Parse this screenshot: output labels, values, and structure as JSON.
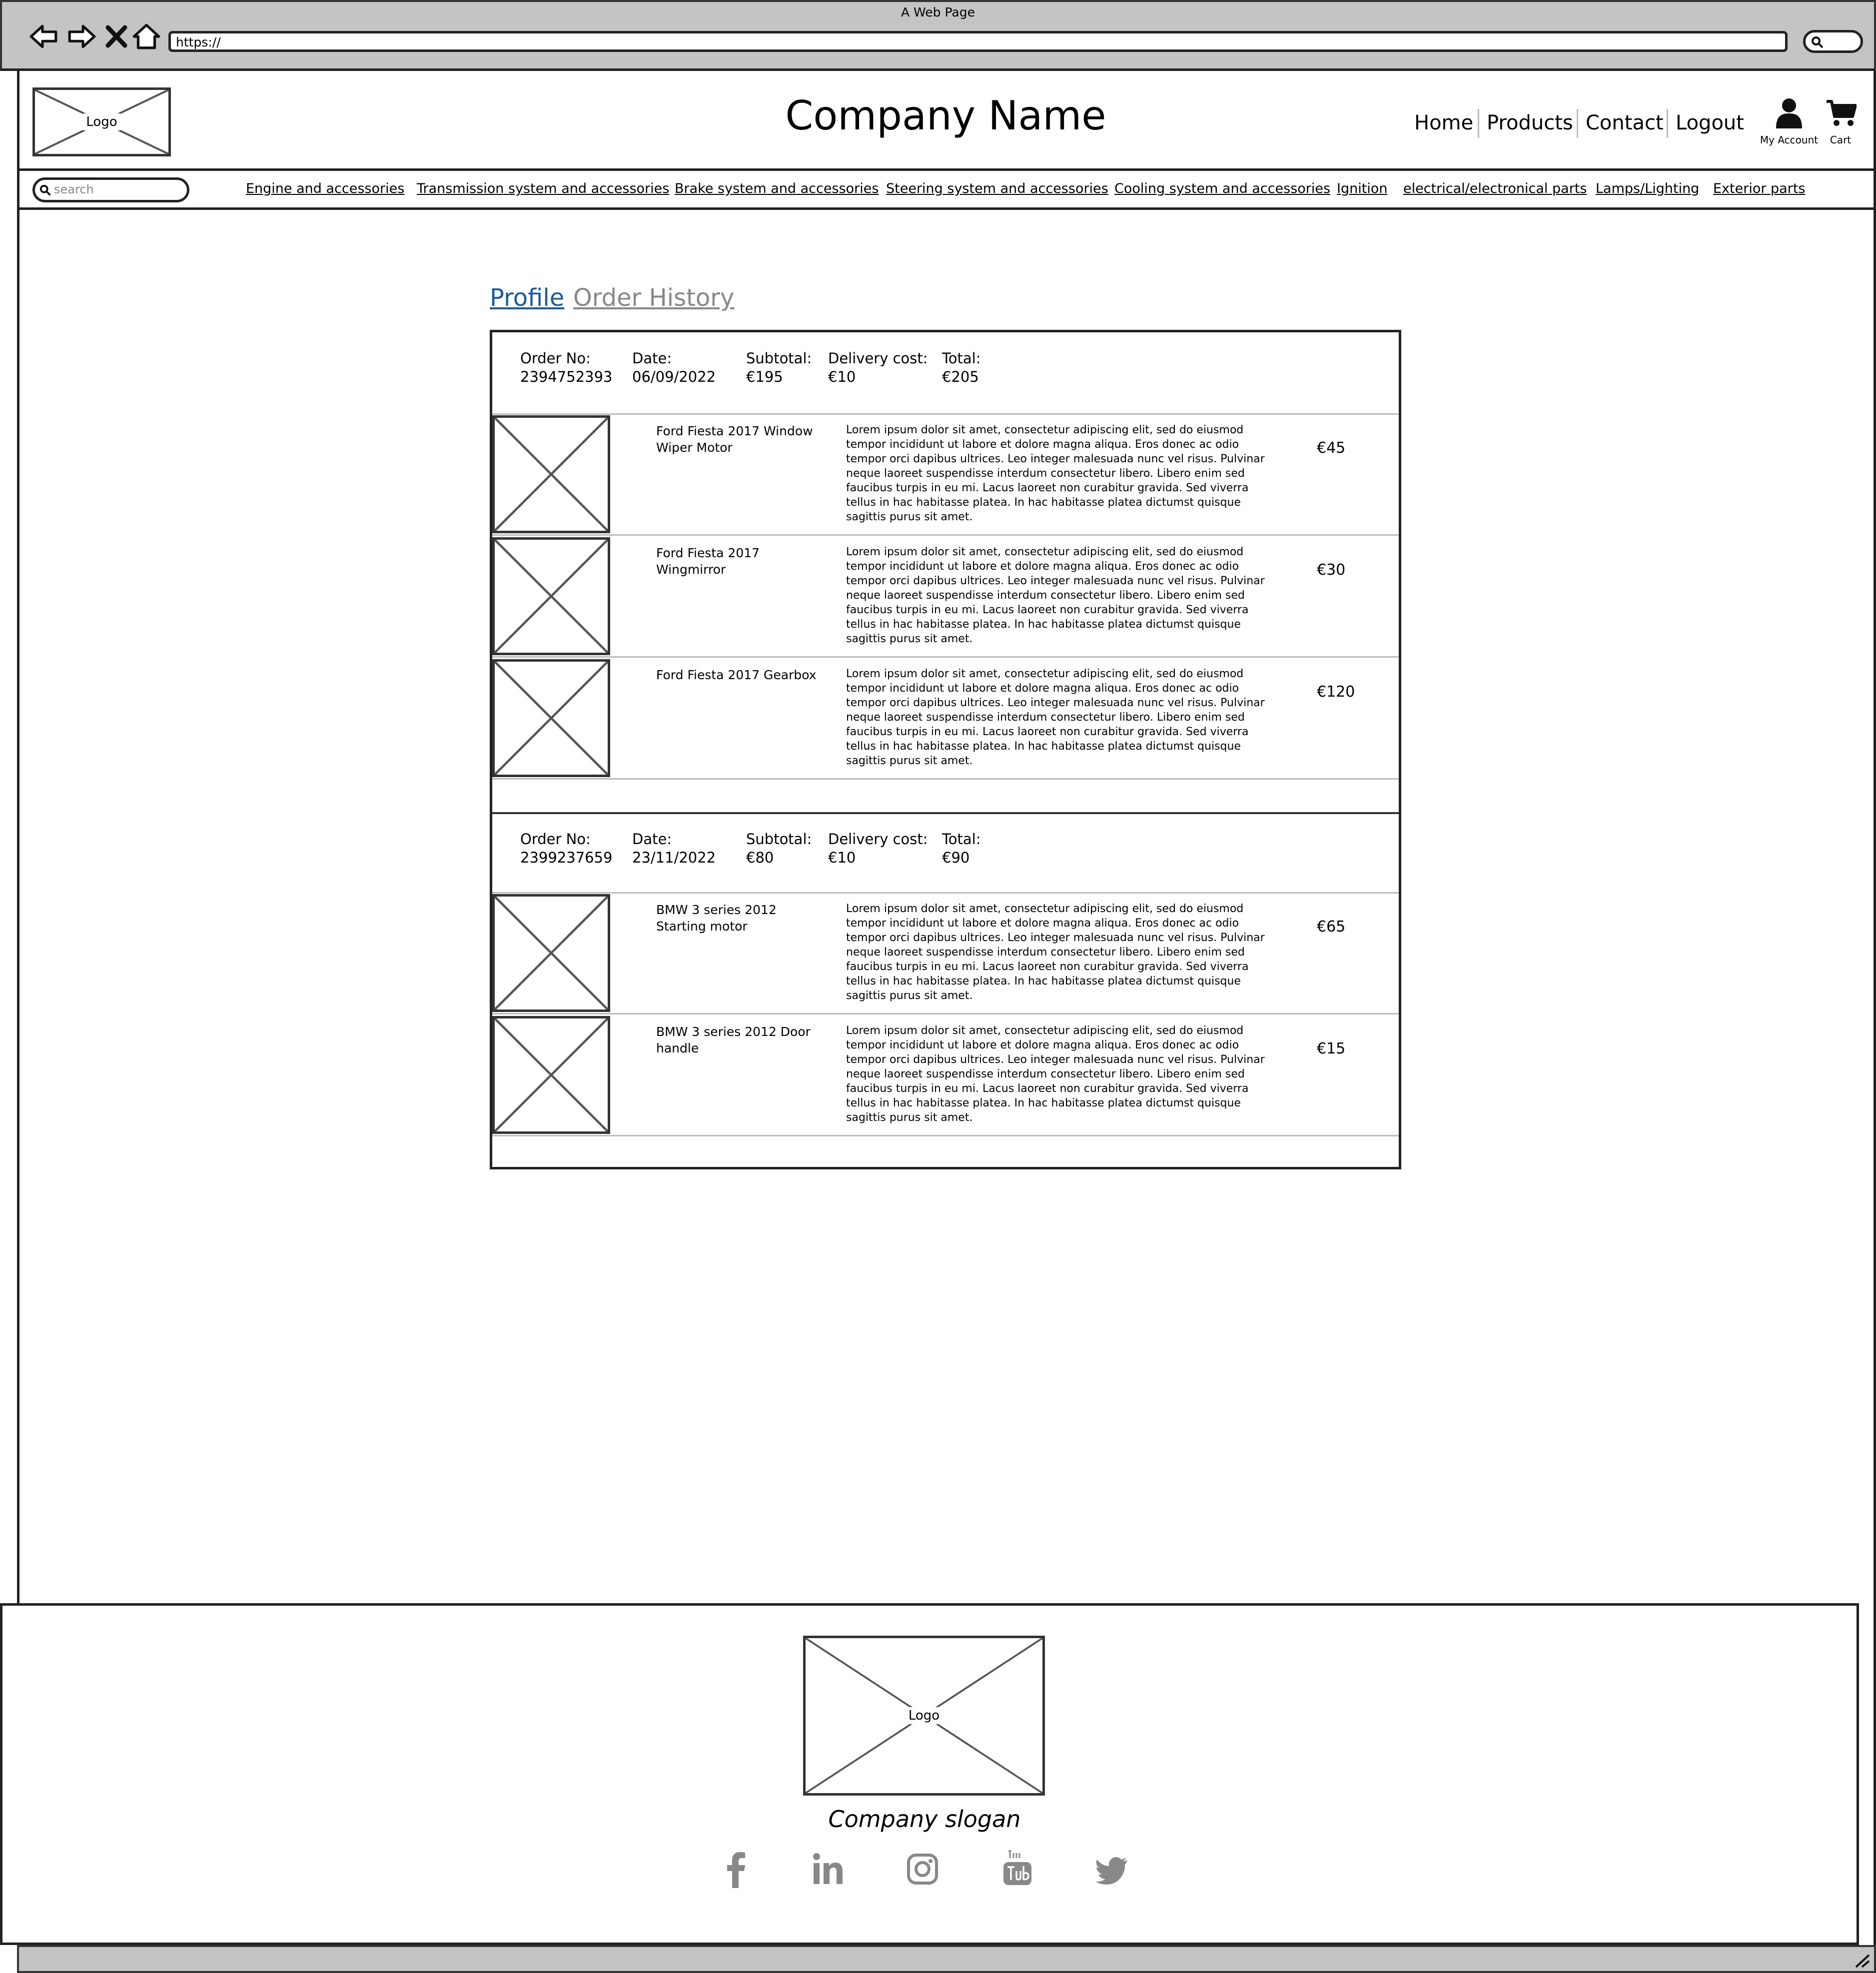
{
  "browser": {
    "title": "A Web Page",
    "url": "https://"
  },
  "header": {
    "logo": "Logo",
    "company_name": "Company Name",
    "nav": [
      "Home",
      "Products",
      "Contact",
      "Logout"
    ],
    "account_label": "My Account",
    "cart_label": "Cart"
  },
  "search": {
    "placeholder": "search"
  },
  "categories": [
    "Engine and accessories",
    "Transmission system and accessories",
    "Brake system and accessories",
    "Steering system and accessories",
    "Cooling system and accessories",
    "Ignition",
    "electrical/electronical parts",
    "Lamps/Lighting",
    "Exterior parts"
  ],
  "tabs": {
    "profile": "Profile",
    "order_history": "Order History"
  },
  "meta_labels": {
    "order_no": "Order No:",
    "date": "Date:",
    "subtotal": "Subtotal:",
    "delivery": "Delivery cost:",
    "total": "Total:"
  },
  "orders": [
    {
      "order_no": "2394752393",
      "date": "06/09/2022",
      "subtotal": "€195",
      "delivery": "€10",
      "total": "€205",
      "items": [
        {
          "name": "Ford Fiesta 2017 Window Wiper Motor",
          "price": "€45"
        },
        {
          "name": "Ford Fiesta 2017 Wingmirror",
          "price": "€30"
        },
        {
          "name": "Ford Fiesta 2017 Gearbox",
          "price": "€120"
        }
      ]
    },
    {
      "order_no": "2399237659",
      "date": "23/11/2022",
      "subtotal": "€80",
      "delivery": "€10",
      "total": "€90",
      "items": [
        {
          "name": "BMW 3 series 2012 Starting motor",
          "price": "€65"
        },
        {
          "name": "BMW 3 series 2012 Door handle",
          "price": "€15"
        }
      ]
    }
  ],
  "item_description": "Lorem ipsum dolor sit amet, consectetur adipiscing elit, sed do eiusmod tempor incididunt ut labore et dolore magna aliqua. Eros donec ac odio tempor orci dapibus ultrices. Leo integer malesuada nunc vel risus. Pulvinar neque laoreet suspendisse interdum consectetur libero. Libero enim sed faucibus turpis in eu mi. Lacus laoreet non curabitur gravida. Sed viverra tellus in hac habitasse platea. In hac habitasse platea dictumst quisque sagittis purus sit amet.",
  "footer": {
    "logo": "Logo",
    "slogan": "Company slogan",
    "social": [
      "facebook-icon",
      "linkedin-icon",
      "instagram-icon",
      "youtube-icon",
      "twitter-icon"
    ],
    "social_color": "#888888"
  }
}
